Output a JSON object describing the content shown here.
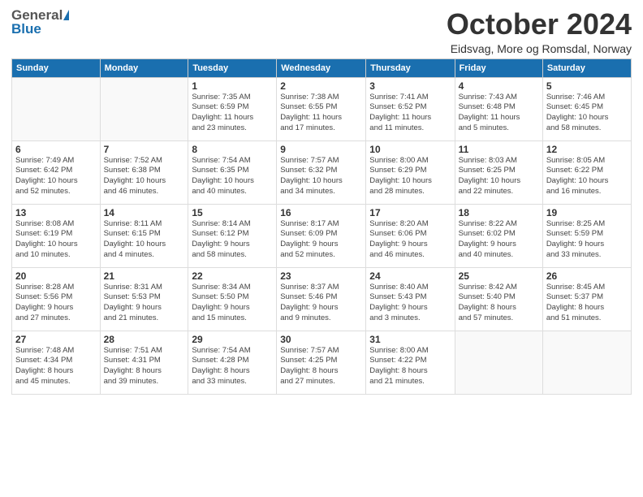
{
  "header": {
    "logo_general": "General",
    "logo_blue": "Blue",
    "month": "October 2024",
    "location": "Eidsvag, More og Romsdal, Norway"
  },
  "weekdays": [
    "Sunday",
    "Monday",
    "Tuesday",
    "Wednesday",
    "Thursday",
    "Friday",
    "Saturday"
  ],
  "weeks": [
    [
      {
        "day": "",
        "info": ""
      },
      {
        "day": "",
        "info": ""
      },
      {
        "day": "1",
        "info": "Sunrise: 7:35 AM\nSunset: 6:59 PM\nDaylight: 11 hours\nand 23 minutes."
      },
      {
        "day": "2",
        "info": "Sunrise: 7:38 AM\nSunset: 6:55 PM\nDaylight: 11 hours\nand 17 minutes."
      },
      {
        "day": "3",
        "info": "Sunrise: 7:41 AM\nSunset: 6:52 PM\nDaylight: 11 hours\nand 11 minutes."
      },
      {
        "day": "4",
        "info": "Sunrise: 7:43 AM\nSunset: 6:48 PM\nDaylight: 11 hours\nand 5 minutes."
      },
      {
        "day": "5",
        "info": "Sunrise: 7:46 AM\nSunset: 6:45 PM\nDaylight: 10 hours\nand 58 minutes."
      }
    ],
    [
      {
        "day": "6",
        "info": "Sunrise: 7:49 AM\nSunset: 6:42 PM\nDaylight: 10 hours\nand 52 minutes."
      },
      {
        "day": "7",
        "info": "Sunrise: 7:52 AM\nSunset: 6:38 PM\nDaylight: 10 hours\nand 46 minutes."
      },
      {
        "day": "8",
        "info": "Sunrise: 7:54 AM\nSunset: 6:35 PM\nDaylight: 10 hours\nand 40 minutes."
      },
      {
        "day": "9",
        "info": "Sunrise: 7:57 AM\nSunset: 6:32 PM\nDaylight: 10 hours\nand 34 minutes."
      },
      {
        "day": "10",
        "info": "Sunrise: 8:00 AM\nSunset: 6:29 PM\nDaylight: 10 hours\nand 28 minutes."
      },
      {
        "day": "11",
        "info": "Sunrise: 8:03 AM\nSunset: 6:25 PM\nDaylight: 10 hours\nand 22 minutes."
      },
      {
        "day": "12",
        "info": "Sunrise: 8:05 AM\nSunset: 6:22 PM\nDaylight: 10 hours\nand 16 minutes."
      }
    ],
    [
      {
        "day": "13",
        "info": "Sunrise: 8:08 AM\nSunset: 6:19 PM\nDaylight: 10 hours\nand 10 minutes."
      },
      {
        "day": "14",
        "info": "Sunrise: 8:11 AM\nSunset: 6:15 PM\nDaylight: 10 hours\nand 4 minutes."
      },
      {
        "day": "15",
        "info": "Sunrise: 8:14 AM\nSunset: 6:12 PM\nDaylight: 9 hours\nand 58 minutes."
      },
      {
        "day": "16",
        "info": "Sunrise: 8:17 AM\nSunset: 6:09 PM\nDaylight: 9 hours\nand 52 minutes."
      },
      {
        "day": "17",
        "info": "Sunrise: 8:20 AM\nSunset: 6:06 PM\nDaylight: 9 hours\nand 46 minutes."
      },
      {
        "day": "18",
        "info": "Sunrise: 8:22 AM\nSunset: 6:02 PM\nDaylight: 9 hours\nand 40 minutes."
      },
      {
        "day": "19",
        "info": "Sunrise: 8:25 AM\nSunset: 5:59 PM\nDaylight: 9 hours\nand 33 minutes."
      }
    ],
    [
      {
        "day": "20",
        "info": "Sunrise: 8:28 AM\nSunset: 5:56 PM\nDaylight: 9 hours\nand 27 minutes."
      },
      {
        "day": "21",
        "info": "Sunrise: 8:31 AM\nSunset: 5:53 PM\nDaylight: 9 hours\nand 21 minutes."
      },
      {
        "day": "22",
        "info": "Sunrise: 8:34 AM\nSunset: 5:50 PM\nDaylight: 9 hours\nand 15 minutes."
      },
      {
        "day": "23",
        "info": "Sunrise: 8:37 AM\nSunset: 5:46 PM\nDaylight: 9 hours\nand 9 minutes."
      },
      {
        "day": "24",
        "info": "Sunrise: 8:40 AM\nSunset: 5:43 PM\nDaylight: 9 hours\nand 3 minutes."
      },
      {
        "day": "25",
        "info": "Sunrise: 8:42 AM\nSunset: 5:40 PM\nDaylight: 8 hours\nand 57 minutes."
      },
      {
        "day": "26",
        "info": "Sunrise: 8:45 AM\nSunset: 5:37 PM\nDaylight: 8 hours\nand 51 minutes."
      }
    ],
    [
      {
        "day": "27",
        "info": "Sunrise: 7:48 AM\nSunset: 4:34 PM\nDaylight: 8 hours\nand 45 minutes."
      },
      {
        "day": "28",
        "info": "Sunrise: 7:51 AM\nSunset: 4:31 PM\nDaylight: 8 hours\nand 39 minutes."
      },
      {
        "day": "29",
        "info": "Sunrise: 7:54 AM\nSunset: 4:28 PM\nDaylight: 8 hours\nand 33 minutes."
      },
      {
        "day": "30",
        "info": "Sunrise: 7:57 AM\nSunset: 4:25 PM\nDaylight: 8 hours\nand 27 minutes."
      },
      {
        "day": "31",
        "info": "Sunrise: 8:00 AM\nSunset: 4:22 PM\nDaylight: 8 hours\nand 21 minutes."
      },
      {
        "day": "",
        "info": ""
      },
      {
        "day": "",
        "info": ""
      }
    ]
  ]
}
